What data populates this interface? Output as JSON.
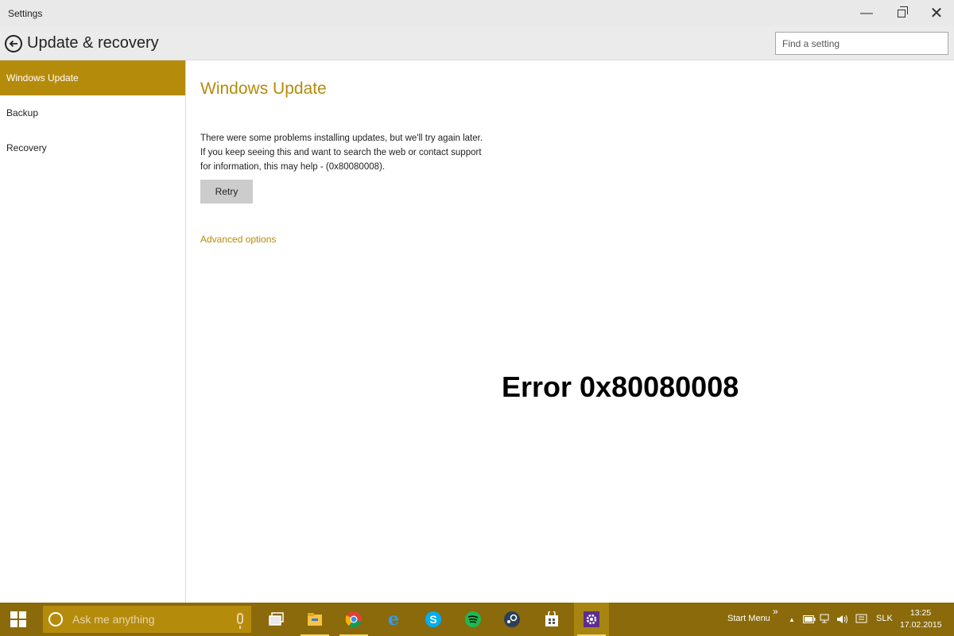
{
  "window": {
    "title": "Settings",
    "minimize": "—",
    "close": "✕"
  },
  "header": {
    "title": "Update & recovery",
    "search_placeholder": "Find a setting"
  },
  "sidebar": {
    "items": [
      {
        "label": "Windows Update",
        "active": true
      },
      {
        "label": "Backup",
        "active": false
      },
      {
        "label": "Recovery",
        "active": false
      }
    ]
  },
  "main": {
    "title": "Windows Update",
    "message_lines": [
      "There were some problems installing updates, but we'll try again later.",
      "If you keep seeing this and want to search the web or contact support",
      "for information, this may help - (0x80080008)."
    ],
    "retry_label": "Retry",
    "advanced_link": "Advanced options"
  },
  "overlay": {
    "error_caption": "Error 0x80080008"
  },
  "taskbar": {
    "search_placeholder": "Ask me anything",
    "pinned_icons": [
      "task-view-icon",
      "file-explorer-icon",
      "chrome-icon",
      "internet-explorer-icon",
      "skype-icon",
      "spotify-icon",
      "steam-icon",
      "store-icon",
      "settings-icon"
    ],
    "start_menu_label": "Start Menu",
    "overflow_chevron": "»",
    "tray_up_arrow": "▲",
    "language": "SLK",
    "time": "13:25",
    "date": "17.02.2015"
  },
  "colors": {
    "accent": "#b58b0c",
    "taskbar": "#8a6a0b",
    "titlebar": "#e9e9e9"
  }
}
